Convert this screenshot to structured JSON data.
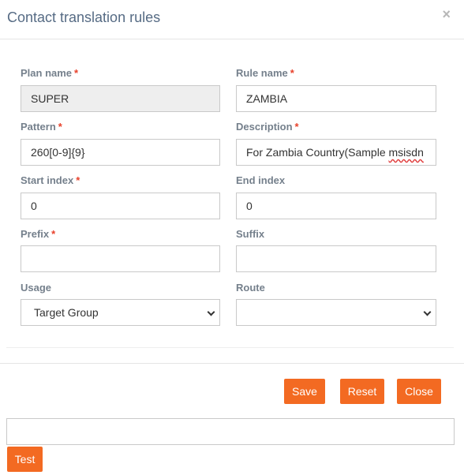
{
  "dialog": {
    "title": "Contact translation rules",
    "close_glyph": "×"
  },
  "form": {
    "required_marker": "*",
    "plan_name": {
      "label": "Plan name",
      "value": "SUPER"
    },
    "rule_name": {
      "label": "Rule name",
      "value": "ZAMBIA"
    },
    "pattern": {
      "label": "Pattern",
      "value": "260[0-9]{9}"
    },
    "description": {
      "label": "Description",
      "value_prefix": "For Zambia Country(Sample ",
      "value_misspelled": "msisdn"
    },
    "start_index": {
      "label": "Start index",
      "value": "0"
    },
    "end_index": {
      "label": "End index",
      "value": "0"
    },
    "prefix": {
      "label": "Prefix",
      "value": ""
    },
    "suffix": {
      "label": "Suffix",
      "value": ""
    },
    "usage": {
      "label": "Usage",
      "selected": "Target Group"
    },
    "route": {
      "label": "Route",
      "selected": ""
    }
  },
  "footer": {
    "save_label": "Save",
    "reset_label": "Reset",
    "close_label": "Close"
  },
  "test": {
    "input_value": "",
    "button_label": "Test"
  },
  "colors": {
    "accent": "#f36a22",
    "title": "#566b84",
    "label": "#75808c",
    "required": "#e8412b"
  },
  "icons": {
    "close": "close-icon",
    "select_arrow": "chevron-down-icon"
  }
}
